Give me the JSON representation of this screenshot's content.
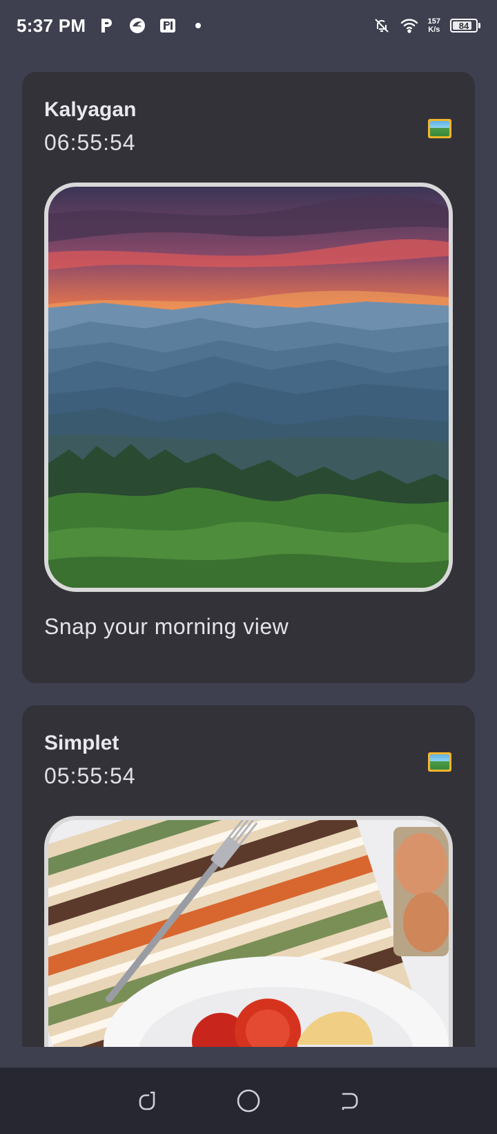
{
  "status_bar": {
    "time": "5:37 PM",
    "network_speed_value": "157",
    "network_speed_unit": "K/s",
    "battery_level": "84",
    "icons": [
      "p-app-icon",
      "bird-app-icon",
      "pi-app-icon",
      "dot-icon",
      "bell-off-icon",
      "wifi-icon",
      "battery-icon"
    ]
  },
  "feed": {
    "cards": [
      {
        "title": "Kalyagan",
        "time": "06:55:54",
        "icon": "framed-picture-icon",
        "image": "mountain-sunset-photo",
        "caption": "Snap your morning view"
      },
      {
        "title": "Simplet",
        "time": "05:55:54",
        "icon": "framed-picture-icon",
        "image": "breakfast-plate-photo"
      }
    ]
  },
  "nav_bar": {
    "buttons": [
      "recent-apps-icon",
      "home-icon",
      "back-icon"
    ]
  },
  "colors": {
    "background": "#3e4050",
    "card": "#333239",
    "nav": "#272731",
    "frame": "#d9d9d9",
    "icon_frame": "#f5b52a"
  }
}
